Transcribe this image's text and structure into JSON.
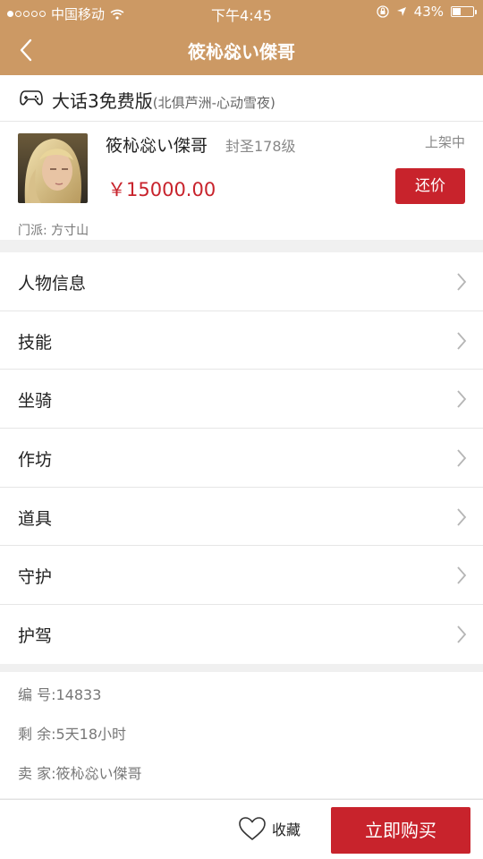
{
  "status_bar": {
    "carrier": "中国移动",
    "time": "下午4:45",
    "battery": "43%",
    "battery_level": 0.43
  },
  "nav": {
    "title": "筱杺惢い傑哥"
  },
  "game": {
    "name": "大话3免费版",
    "server": "(北俱芦洲-心动雪夜)"
  },
  "product": {
    "name": "筱杺惢い傑哥",
    "level": "封圣178级",
    "status": "上架中",
    "price": "￥15000.00",
    "bargain_label": "还价",
    "sect": "门派: 方寸山"
  },
  "menu": [
    {
      "label": "人物信息"
    },
    {
      "label": "技能"
    },
    {
      "label": "坐骑"
    },
    {
      "label": "作坊"
    },
    {
      "label": "道具"
    },
    {
      "label": "守护"
    },
    {
      "label": "护驾"
    }
  ],
  "info": {
    "id": "编  号:14833",
    "remaining": "剩  余:5天18小时",
    "seller": "卖  家:筱杺惢い傑哥"
  },
  "bottom": {
    "fav_label": "收藏",
    "buy_label": "立即购买"
  },
  "colors": {
    "accent": "#cc9964",
    "brand_red": "#c8232c"
  }
}
